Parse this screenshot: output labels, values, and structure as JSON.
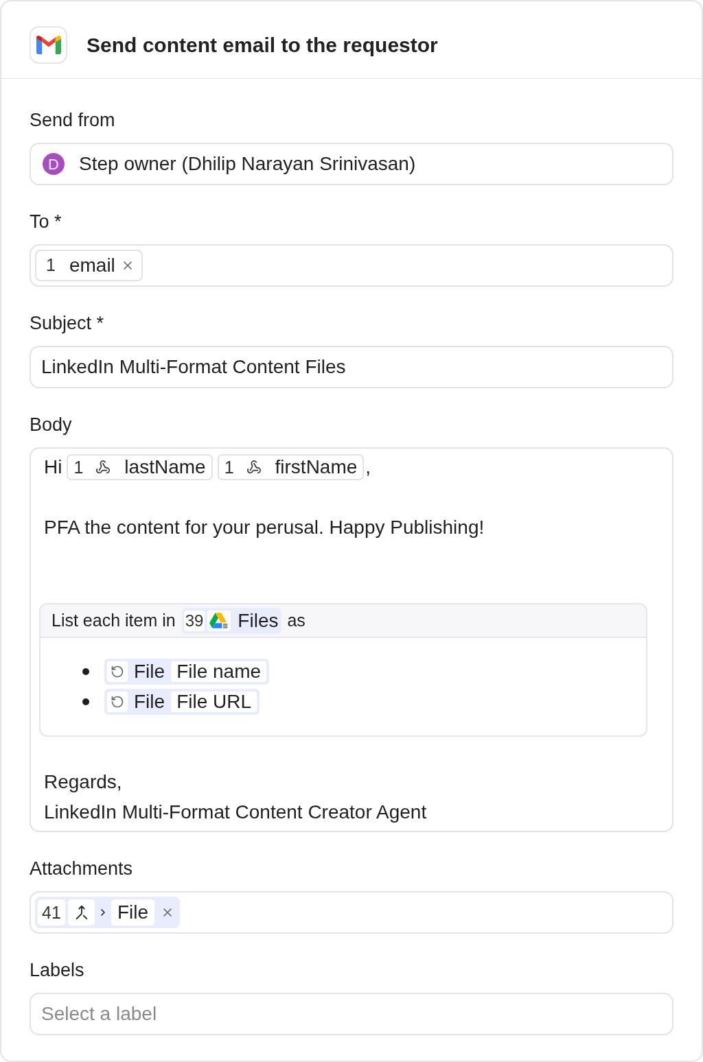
{
  "header": {
    "title": "Send content email to the requestor"
  },
  "send_from": {
    "label": "Send from",
    "avatar": "D",
    "value": "Step owner (Dhilip Narayan Srinivasan)"
  },
  "to": {
    "label": "To *",
    "tokens": [
      {
        "step": "1",
        "name": "email"
      }
    ]
  },
  "subject": {
    "label": "Subject *",
    "value": "LinkedIn Multi-Format Content Files"
  },
  "body": {
    "label": "Body",
    "greeting": "Hi",
    "greeting_tokens": [
      {
        "step": "1",
        "name": "lastName"
      },
      {
        "step": "1",
        "name": "firstName"
      }
    ],
    "greeting_end": ",",
    "paragraph": "PFA the content for your perusal. Happy Publishing!",
    "loop": {
      "prefix": "List each item in",
      "source": {
        "step": "39",
        "name": "Files"
      },
      "suffix": "as",
      "items": [
        {
          "source": "File",
          "field": "File name"
        },
        {
          "source": "File",
          "field": "File URL"
        }
      ]
    },
    "closing": [
      "Regards,",
      "LinkedIn Multi-Format Content Creator Agent"
    ]
  },
  "attachments": {
    "label": "Attachments",
    "tokens": [
      {
        "step": "41",
        "name": "File"
      }
    ]
  },
  "labels": {
    "label": "Labels",
    "placeholder": "Select a label"
  }
}
